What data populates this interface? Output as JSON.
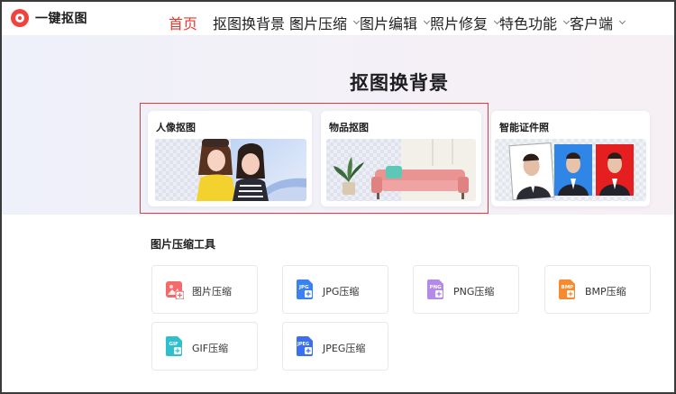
{
  "app": {
    "name": "一键抠图"
  },
  "nav": [
    {
      "label": "首页",
      "active": true,
      "dropdown": false
    },
    {
      "label": "抠图换背景",
      "active": false,
      "dropdown": true
    },
    {
      "label": "图片压缩",
      "active": false,
      "dropdown": true
    },
    {
      "label": "图片编辑",
      "active": false,
      "dropdown": true
    },
    {
      "label": "照片修复",
      "active": false,
      "dropdown": true
    },
    {
      "label": "特色功能",
      "active": false,
      "dropdown": true
    },
    {
      "label": "客户端",
      "active": false,
      "dropdown": true
    }
  ],
  "hero": {
    "title": "抠图换背景",
    "cards": [
      {
        "title": "人像抠图",
        "image": "two-women-portrait"
      },
      {
        "title": "物品抠图",
        "image": "sofa-and-plant"
      },
      {
        "title": "智能证件照",
        "image": "id-photos-white-blue-red"
      }
    ]
  },
  "compress": {
    "title": "图片压缩工具",
    "tools": [
      {
        "label": "图片压缩",
        "icon": "image-compress-icon",
        "badge": "",
        "color": "#f26a6a"
      },
      {
        "label": "JPG压缩",
        "icon": "jpg-file-icon",
        "badge": "JPG",
        "color": "#3a82f0"
      },
      {
        "label": "PNG压缩",
        "icon": "png-file-icon",
        "badge": "PNG",
        "color": "#a77be6"
      },
      {
        "label": "BMP压缩",
        "icon": "bmp-file-icon",
        "badge": "BMP",
        "color": "#f58a2e"
      },
      {
        "label": "GIF压缩",
        "icon": "gif-file-icon",
        "badge": "GIF",
        "color": "#2fbfcf"
      },
      {
        "label": "JPEG压缩",
        "icon": "jpeg-file-icon",
        "badge": "JPEG",
        "color": "#3a6ff0"
      }
    ]
  }
}
